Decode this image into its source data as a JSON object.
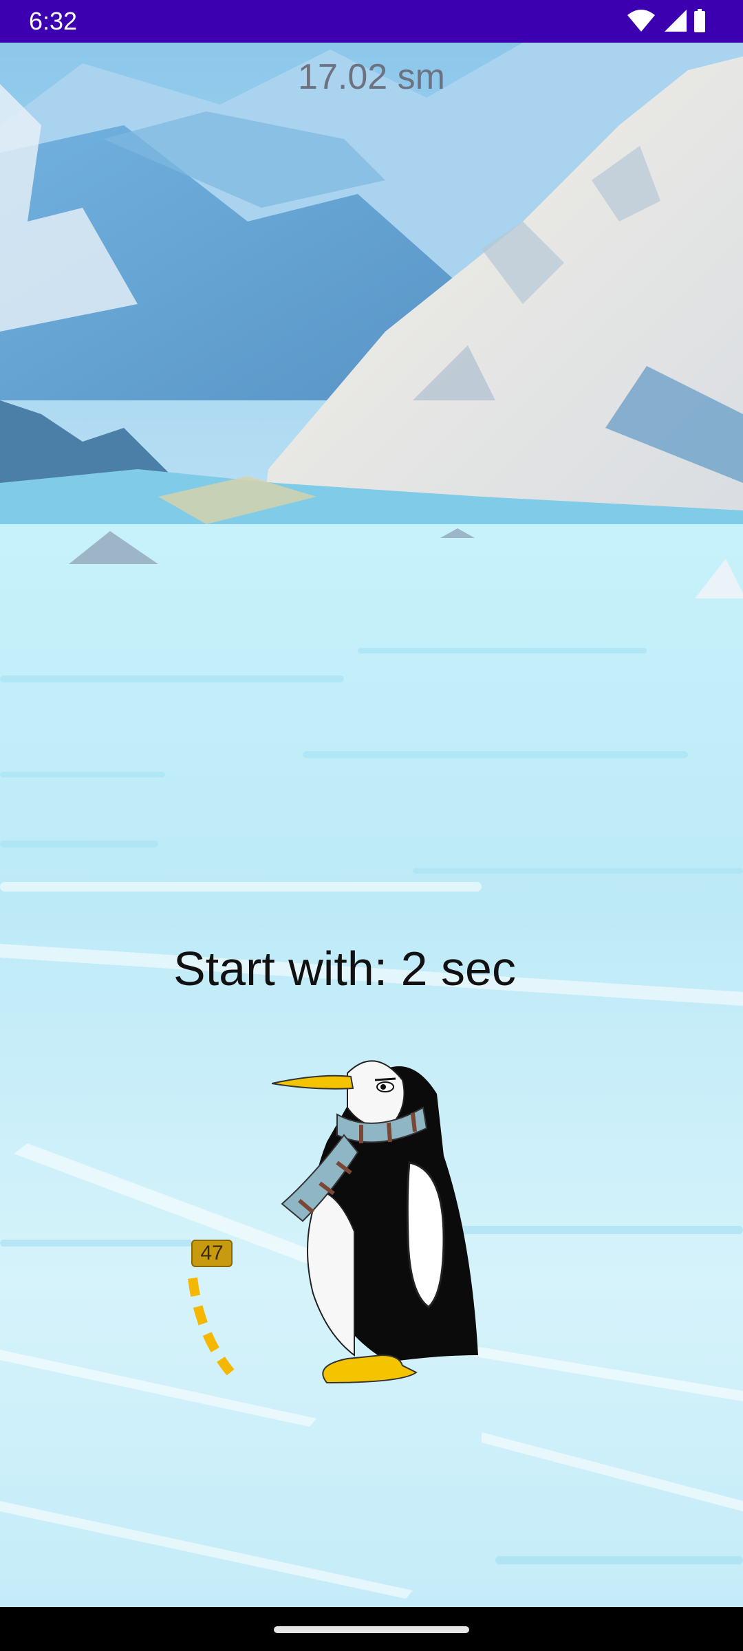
{
  "status_bar": {
    "time": "6:32",
    "icons": [
      "wifi-icon",
      "signal-icon",
      "battery-icon"
    ],
    "background_color": "#3d00b0"
  },
  "game": {
    "distance": "17.02 sm",
    "start_text": "Start with: 2 sec",
    "power_value": "47",
    "accent_color": "#f5b800"
  },
  "nav_bar": {
    "home_indicator": "home-pill"
  }
}
